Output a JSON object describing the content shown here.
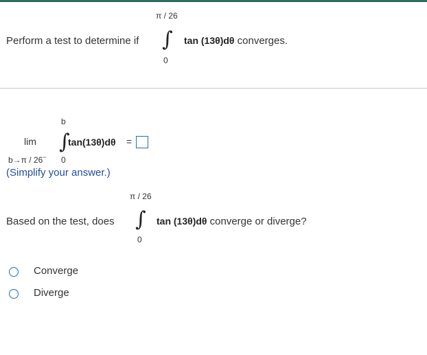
{
  "header": {
    "prompt": "Perform a test to determine if",
    "upper_limit": "π / 26",
    "lower_limit": "0",
    "integrand": "tan (13θ)dθ",
    "suffix": "converges."
  },
  "limit_part": {
    "lim": "lim",
    "approach": "b→π / 26",
    "approach_sup": "−",
    "upper_limit": "b",
    "lower_limit": "0",
    "integrand": "tan(13θ)dθ",
    "equals": "=",
    "answer_value": "",
    "hint": "(Simplify your answer.)"
  },
  "question": {
    "prompt": "Based on the test, does",
    "upper_limit": "π / 26",
    "lower_limit": "0",
    "integrand": "tan (13θ)dθ",
    "suffix": "converge or diverge?"
  },
  "options": [
    {
      "label": "Converge"
    },
    {
      "label": "Diverge"
    }
  ],
  "colors": {
    "accent": "#1f6fb2",
    "top_rule": "#2e6b5e",
    "hint": "#1f4e9c"
  },
  "icons": {
    "integral": "∫"
  }
}
